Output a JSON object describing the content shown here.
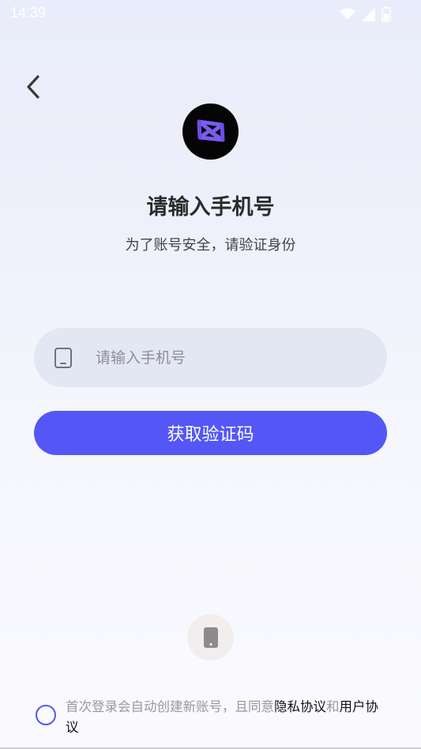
{
  "status_bar": {
    "time": "14:39",
    "icons": [
      "wifi-icon",
      "cellular-signal-icon",
      "battery-icon"
    ]
  },
  "header": {
    "back_icon": "chevron-left-icon"
  },
  "logo": {
    "icon": "app-logo-icon",
    "colors": {
      "background": "#050505",
      "mark": "#7a5cf0"
    }
  },
  "page": {
    "title": "请输入手机号",
    "subtitle": "为了账号安全，请验证身份"
  },
  "phone_input": {
    "icon": "phone-icon",
    "placeholder": "请输入手机号",
    "value": ""
  },
  "get_code_button": {
    "label": "获取验证码",
    "color": "#5457f6"
  },
  "alt_login": {
    "icon": "phone-login-icon"
  },
  "agreement": {
    "checked": false,
    "prefix": "首次登录会自动创建新账号，且同意",
    "privacy_link": "隐私协议",
    "conjunction": "和",
    "user_link": "用户协议"
  },
  "colors": {
    "accent": "#5457f6",
    "field_bg": "#e3e6f3",
    "muted_text": "#999999"
  }
}
